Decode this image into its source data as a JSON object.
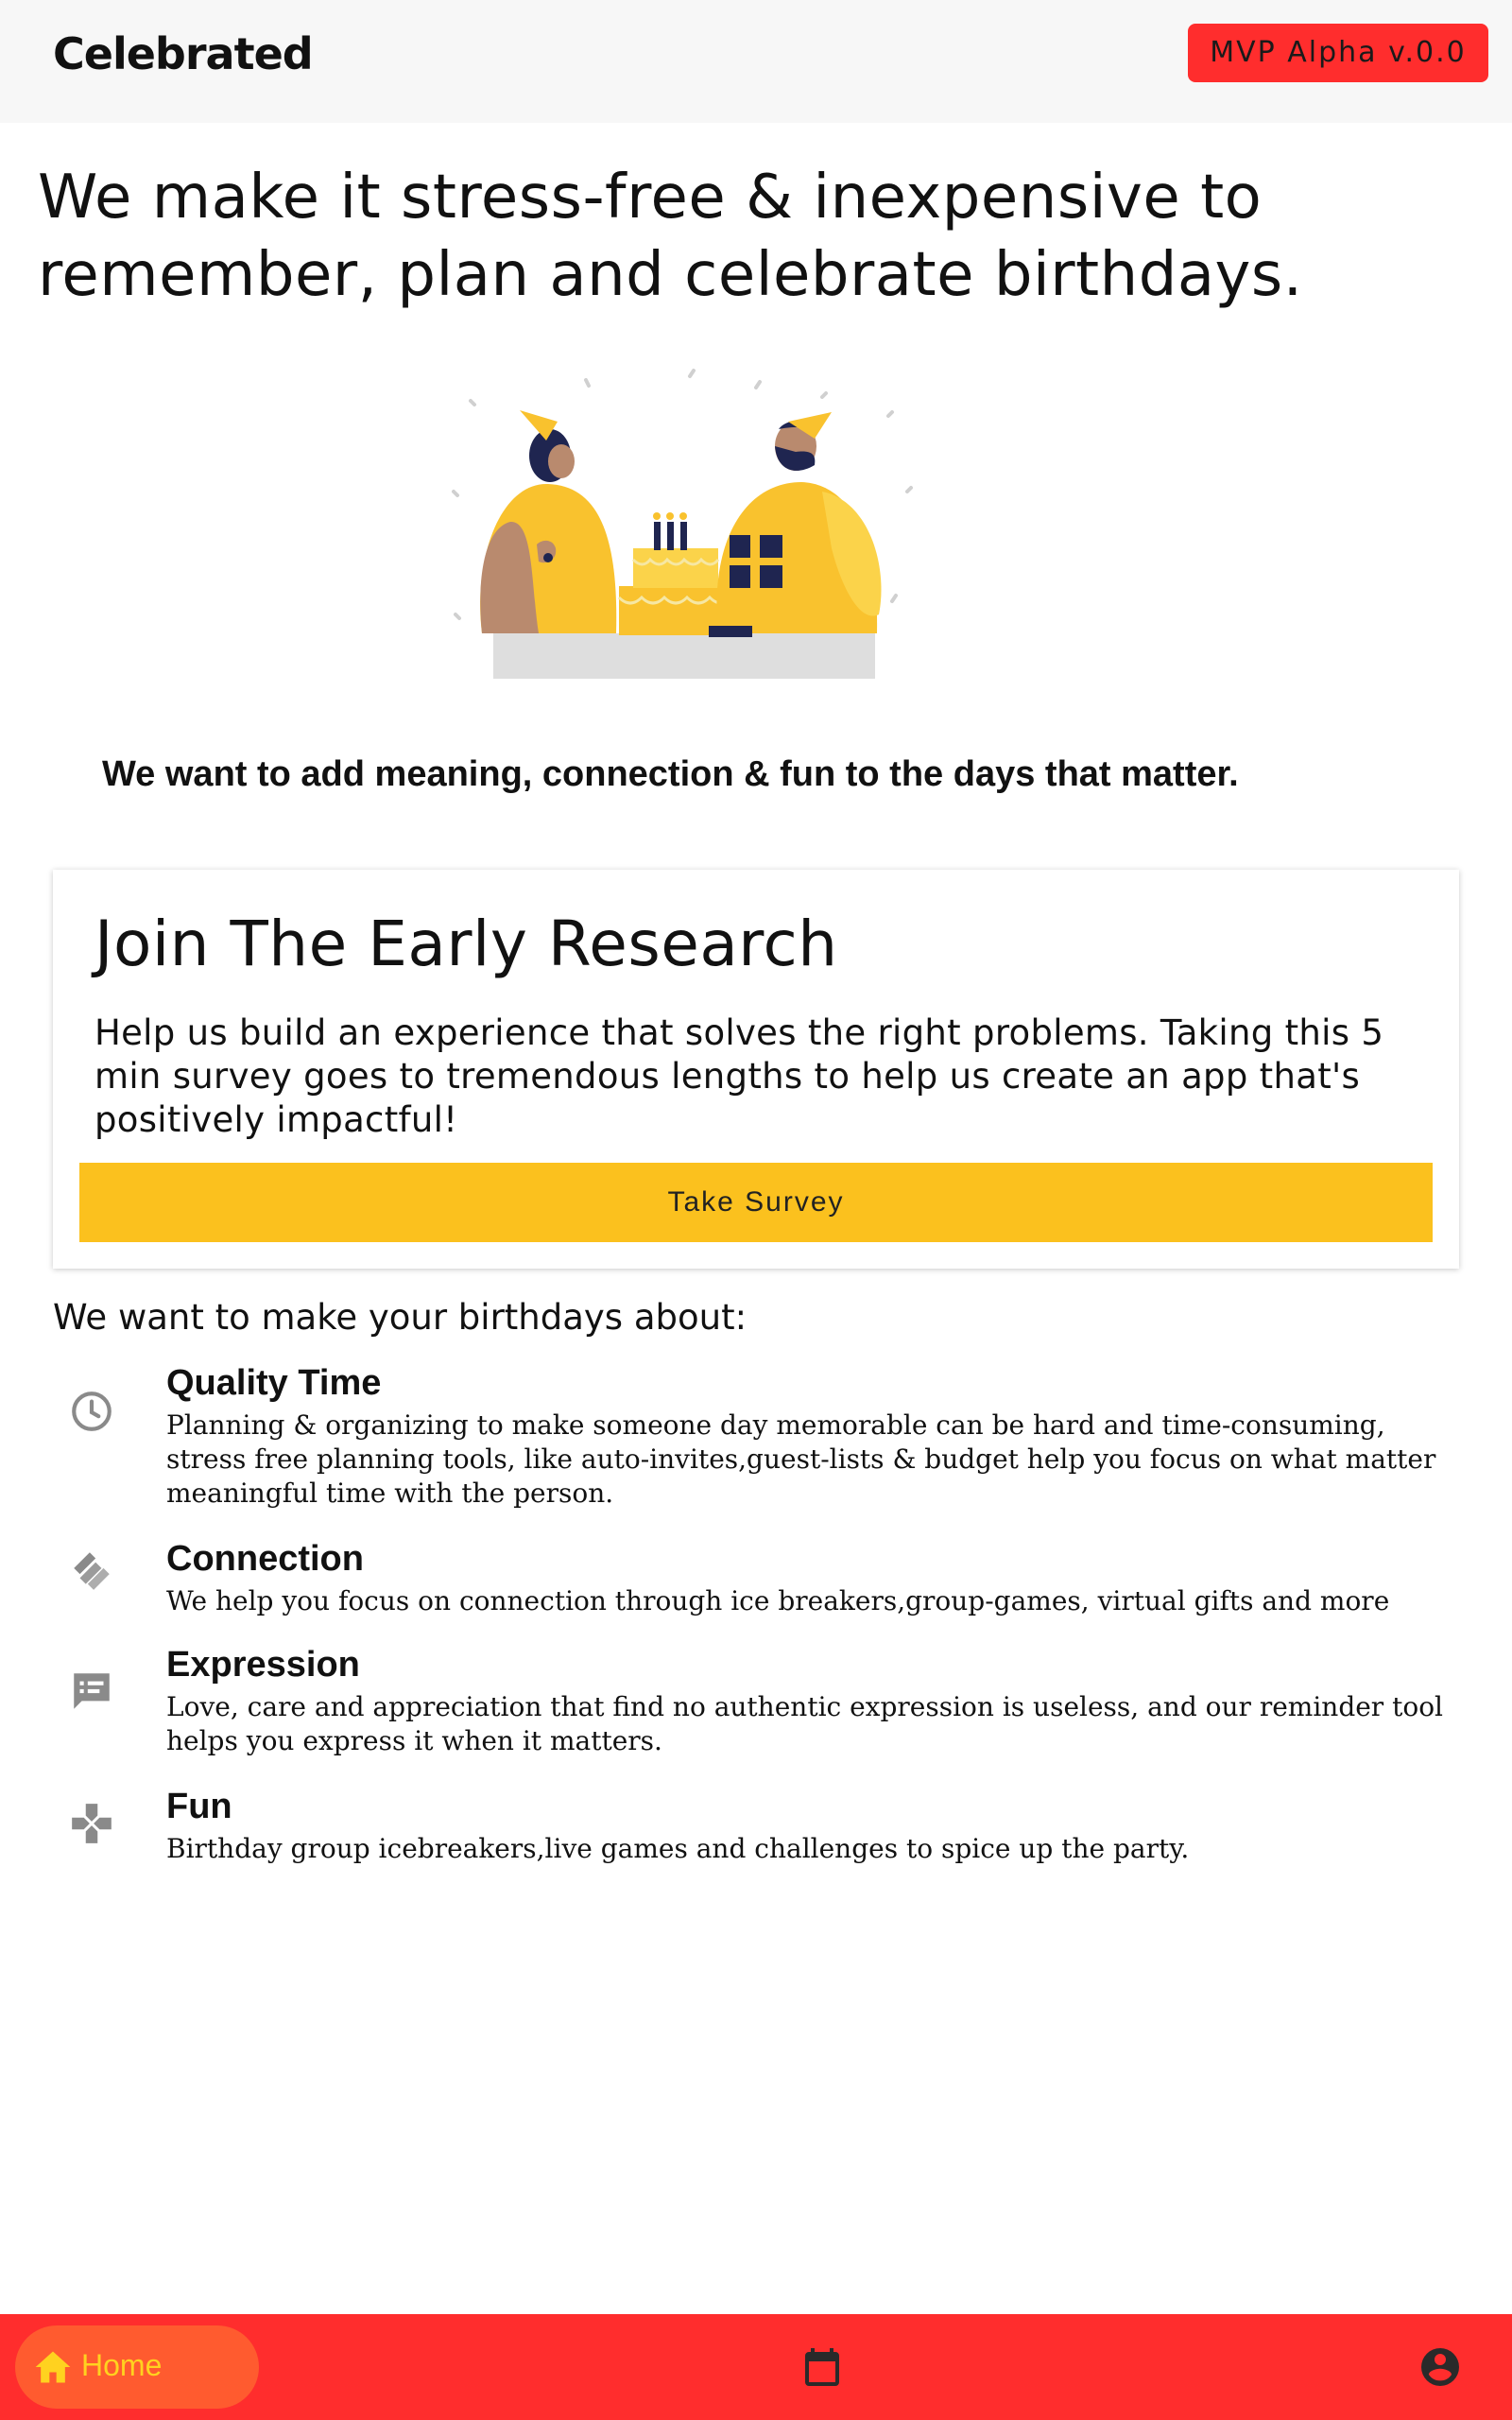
{
  "app": {
    "title": "Celebrated",
    "version_badge": "MVP Alpha v.0.0",
    "accent_red": "#ff2d2d",
    "accent_yellow": "#fbc11e"
  },
  "hero": {
    "headline": "We make it stress-free & inexpensive to remember, plan and celebrate birthdays."
  },
  "illustration": {
    "icon": "birthday-celebration-illustration"
  },
  "mission": {
    "text": "We want to add meaning, connection & fun to the days that matter."
  },
  "research_card": {
    "title": "Join The Early Research",
    "body": "Help us build an experience that solves the right problems. Taking this 5 min survey goes to tremendous lengths to help us create an app that's positively impactful!",
    "button_label": "Take Survey"
  },
  "features": {
    "heading": "We want to make your birthdays about:",
    "items": [
      {
        "icon": "clock-icon",
        "title": "Quality Time",
        "description": "Planning & organizing to make someone day memorable can be hard and time-consuming, stress free planning tools, like auto-invites,guest-lists & budget help you focus on what matter meaningful time with the person."
      },
      {
        "icon": "handshake-icon",
        "title": "Connection",
        "description": "We help you focus on connection through ice breakers,group-games, virtual gifts  and more"
      },
      {
        "icon": "feedback-icon",
        "title": "Expression",
        "description": "Love, care and appreciation that find no authentic expression is useless, and our reminder tool helps you express it when it matters."
      },
      {
        "icon": "gamepad-icon",
        "title": "Fun",
        "description": "Birthday group icebreakers,live games and challenges to spice up the party."
      }
    ]
  },
  "bottom_nav": {
    "home_label": "Home",
    "home_icon": "home-icon",
    "calendar_icon": "calendar-icon",
    "profile_icon": "account-circle-icon"
  }
}
